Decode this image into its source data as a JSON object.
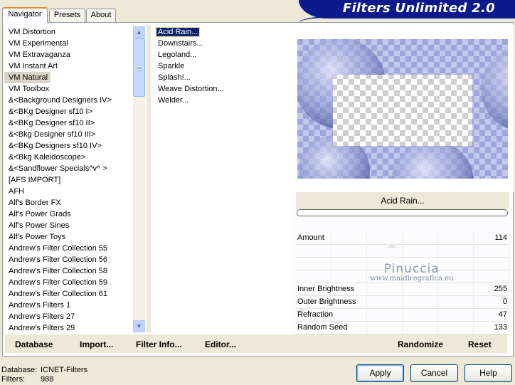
{
  "banner": {
    "title": "Filters Unlimited 2.0"
  },
  "tabs": [
    {
      "label": "Navigator",
      "active": true
    },
    {
      "label": "Presets",
      "active": false
    },
    {
      "label": "About",
      "active": false
    }
  ],
  "categories": [
    "VM Distortion",
    "VM Experimental",
    "VM Extravaganza",
    "VM Instant Art",
    "VM Natural",
    "VM Toolbox",
    "&<Background Designers IV>",
    "&<BKg Designer sf10 I>",
    "&<BKg Designer sf10 II>",
    "&<Bkg Designer sf10 III>",
    "&<BKg Designers sf10 IV>",
    "&<Bkg Kaleidoscope>",
    "&<Sandflower Specials^v^ >",
    "[AFS IMPORT]",
    "AFH",
    "Alf's Border FX",
    "Alf's Power Grads",
    "Alf's Power Sines",
    "Alf's Power Toys",
    "Andrew's Filter Collection 55",
    "Andrew's Filter Collection 56",
    "Andrew's Filter Collection 58",
    "Andrew's Filter Collection 59",
    "Andrew's Filter Collection 61",
    "Andrew's Filters 1",
    "Andrew's Filters 27",
    "Andrew's Filters 29"
  ],
  "selected_category": "VM Natural",
  "filters": [
    "Acid Rain...",
    "Downstairs...",
    "Legoland...",
    "Sparkle",
    "Splash!...",
    "Weave Distortion...",
    "Welder..."
  ],
  "selected_filter": "Acid Rain...",
  "effect_name": "Acid Rain...",
  "params": [
    {
      "label": "Amount",
      "value": "114",
      "level": 0.447
    },
    {
      "label": "",
      "value": "",
      "level": null
    },
    {
      "label": "",
      "value": "",
      "level": null
    },
    {
      "label": "",
      "value": "",
      "level": null
    },
    {
      "label": "Inner Brightness",
      "value": "255",
      "level": 1.0
    },
    {
      "label": "Outer Brightness",
      "value": "0",
      "level": 0.0
    },
    {
      "label": "Refraction",
      "value": "47",
      "level": 0.184
    },
    {
      "label": "Random Seed",
      "value": "133",
      "level": 0.522
    }
  ],
  "watermark": {
    "line1": "Pinuccia",
    "line2": "www.maidiregrafica.eu"
  },
  "toolbar": {
    "database": "Database",
    "import": "Import...",
    "filter_info": "Filter Info...",
    "editor": "Editor...",
    "randomize": "Randomize",
    "reset": "Reset"
  },
  "status": {
    "database_label": "Database:",
    "database_value": "ICNET-Filters",
    "filters_label": "Filters:",
    "filters_value": "988"
  },
  "buttons": {
    "apply": "Apply",
    "cancel": "Cancel",
    "help": "Help"
  },
  "scroll": {
    "up": "scroll-up-arrow",
    "down": "scroll-down-arrow"
  }
}
